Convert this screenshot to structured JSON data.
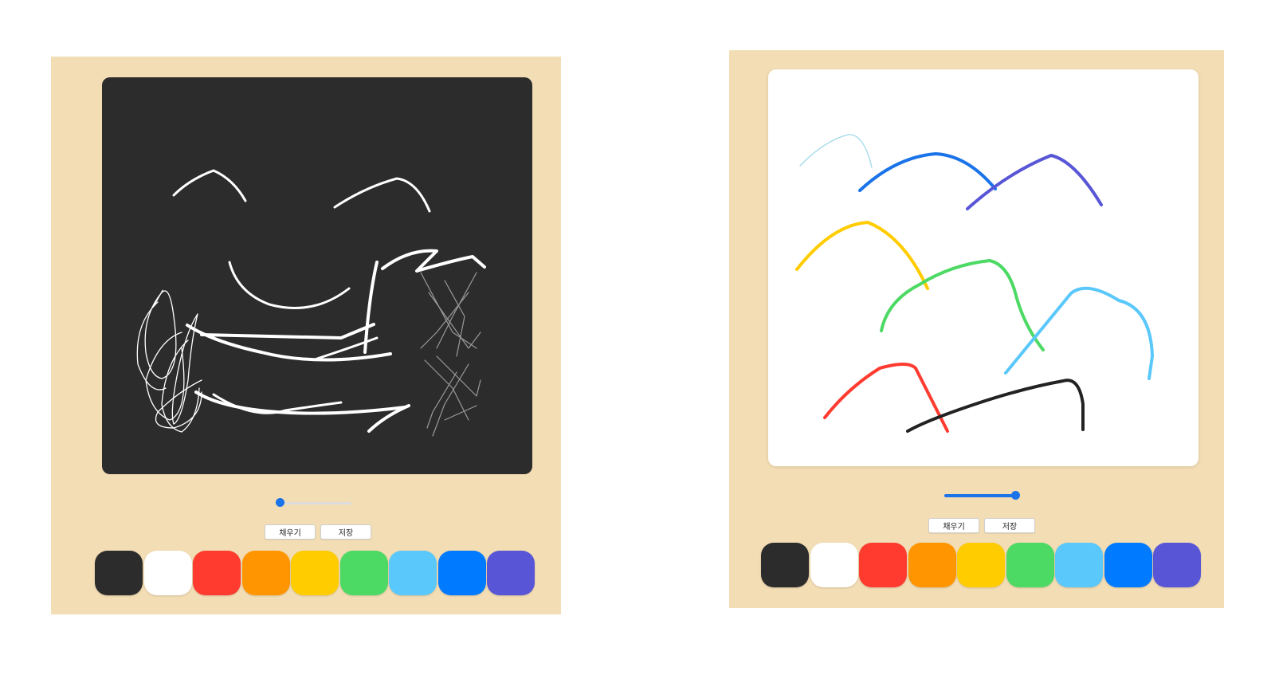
{
  "left_app": {
    "canvas_color": "#2c2c2c",
    "brush_size_fraction": 0.0,
    "buttons": {
      "fill_label": "채우기",
      "save_label": "저장"
    },
    "palette": [
      "#2c2c2c",
      "#ffffff",
      "#ff3b30",
      "#ff9500",
      "#ffcc00",
      "#4cd964",
      "#5ac8fa",
      "#007aff",
      "#5856d6"
    ]
  },
  "right_app": {
    "canvas_color": "#ffffff",
    "brush_size_fraction": 1.0,
    "buttons": {
      "fill_label": "채우기",
      "save_label": "저장"
    },
    "palette": [
      "#2c2c2c",
      "#ffffff",
      "#ff3b30",
      "#ff9500",
      "#ffcc00",
      "#4cd964",
      "#5ac8fa",
      "#007aff",
      "#5856d6"
    ]
  }
}
